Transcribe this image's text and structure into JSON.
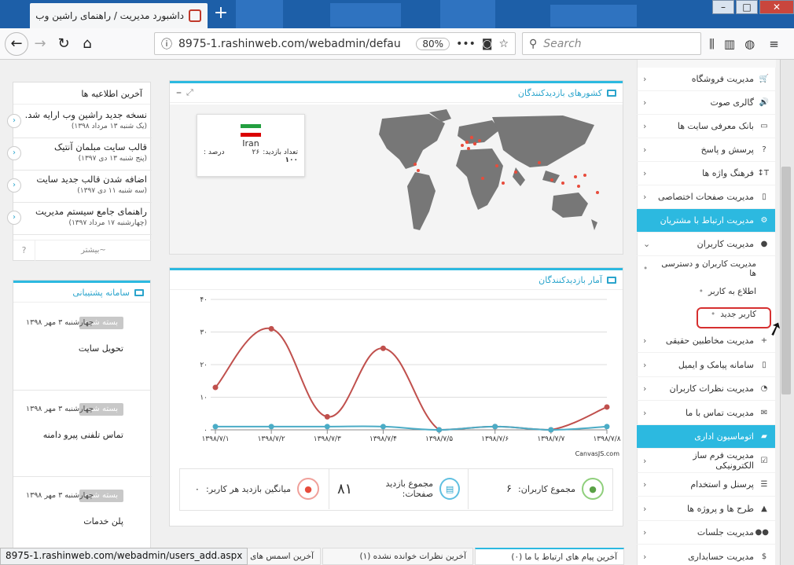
{
  "browser": {
    "tab_title": "داشبورد مدیریت / راهنمای راشین وب",
    "url": "8975-1.rashinweb.com/webadmin/defau",
    "zoom": "80%",
    "search_placeholder": "Search",
    "status_url": "8975-1.rashinweb.com/webadmin/users_add.aspx"
  },
  "sidebar": {
    "items": [
      {
        "label": "مدیریت فروشگاه",
        "icon": "cart-icon"
      },
      {
        "label": "گالری صوت",
        "icon": "speaker-icon"
      },
      {
        "label": "بانک معرفی سایت ها",
        "icon": "monitor-icon"
      },
      {
        "label": "پرسش و پاسخ",
        "icon": "question-icon"
      },
      {
        "label": "فرهنگ واژه ها",
        "icon": "text-height-icon"
      },
      {
        "label": "مدیریت صفحات اختصاصی",
        "icon": "file-icon"
      },
      {
        "label": "مدیریت ارتباط با مشتریان",
        "icon": "users-gear-icon"
      },
      {
        "label": "مدیریت کاربران",
        "icon": "user-icon"
      }
    ],
    "subitems": [
      "مدیریت کاربران و دسترسی ها",
      "اطلاع به کاربر",
      "کاربر جدید"
    ],
    "items2": [
      {
        "label": "مدیریت مخاطبین حقیقی",
        "icon": "user-plus-icon"
      },
      {
        "label": "سامانه پیامک و ایمیل",
        "icon": "mobile-icon"
      },
      {
        "label": "مدیریت نظرات کاربران",
        "icon": "comments-icon"
      },
      {
        "label": "مدیریت تماس با ما",
        "icon": "envelope-icon"
      },
      {
        "label": "اتوماسیون اداری",
        "icon": "folder-open-icon"
      },
      {
        "label": "مدیریت فرم ساز الکترونیکی",
        "icon": "check-square-icon"
      },
      {
        "label": "پرسنل و استخدام",
        "icon": "list-icon"
      },
      {
        "label": "طرح ها و پروژه ها",
        "icon": "road-icon"
      },
      {
        "label": "مدیریت جلسات",
        "icon": "group-icon"
      },
      {
        "label": "مدیریت حسابداری",
        "icon": "dollar-icon"
      }
    ]
  },
  "map_panel": {
    "title": "کشورهای بازدیدکنندگان",
    "country": "Iran",
    "visits_label": "تعداد بازدید:",
    "visits_value": "۲۶",
    "percent_label": "درصد :",
    "percent_value": "۱۰۰"
  },
  "chart_panel": {
    "title": "آمار بازدیدکنندگان",
    "credit": "CanvasJS.com"
  },
  "chart_data": {
    "type": "line",
    "categories": [
      "۱۳۹۸/۷/۱",
      "۱۳۹۸/۷/۲",
      "۱۳۹۸/۷/۳",
      "۱۳۹۸/۷/۴",
      "۱۳۹۸/۷/۵",
      "۱۳۹۸/۷/۶",
      "۱۳۹۸/۷/۷",
      "۱۳۹۸/۷/۸"
    ],
    "yticks": [
      "۰",
      "۱۰",
      "۲۰",
      "۳۰",
      "۴۰"
    ],
    "ylim": [
      0,
      40
    ],
    "series": [
      {
        "values": [
          13,
          31,
          4,
          25,
          0,
          1,
          0,
          7
        ],
        "color": "#c0504d"
      },
      {
        "values": [
          1,
          1,
          1,
          1,
          0,
          1,
          0,
          1
        ],
        "color": "#4bacc6"
      }
    ],
    "grid": true
  },
  "stats": {
    "users_label": "مجموع کاربران:",
    "users_value": "۶",
    "pages_label": "مجموع بازدید صفحات:",
    "pages_value": "۸۱",
    "avg_label": "میانگین بازدید هر کاربر:",
    "avg_value": "۰"
  },
  "news_panel": {
    "title": "آخرین اطلاعیه ها",
    "more": "~بیشتر",
    "help": "?",
    "items": [
      {
        "title": "نسخه جدید راشین وب ارایه شد.",
        "date": "(یک شنبه ۱۳ مرداد ۱۳۹۸)"
      },
      {
        "title": "قالب سایت مبلمان آنتیک",
        "date": "(پنج شنبه ۱۳ دی ۱۳۹۷)"
      },
      {
        "title": "اضافه شدن قالب جدید سایت",
        "date": "(سه شنبه ۱۱ دی ۱۳۹۷)"
      },
      {
        "title": "راهنمای جامع سیستم مدیریت",
        "date": "(چهارشنبه ۱۷ مرداد ۱۳۹۷)"
      }
    ]
  },
  "support_panel": {
    "title": "سامانه پشتیبانی",
    "tickets": [
      {
        "badge": "بسته شده",
        "date": "چهارشنبه ۳ مهر ۱۳۹۸",
        "title": "تحویل سایت"
      },
      {
        "badge": "بسته شده",
        "date": "چهارشنبه ۳ مهر ۱۳۹۸",
        "title": "تماس تلفنی پیرو دامنه"
      },
      {
        "badge": "بسته شده",
        "date": "چهارشنبه ۳ مهر ۱۳۹۸",
        "title": "پلن خدمات"
      }
    ]
  },
  "bottom_tabs": [
    "آخرین پیام های ارتباط با ما (۰)",
    "آخرین نظرات خوانده نشده (۱)",
    "آخرین اسمس های دریافتی"
  ]
}
